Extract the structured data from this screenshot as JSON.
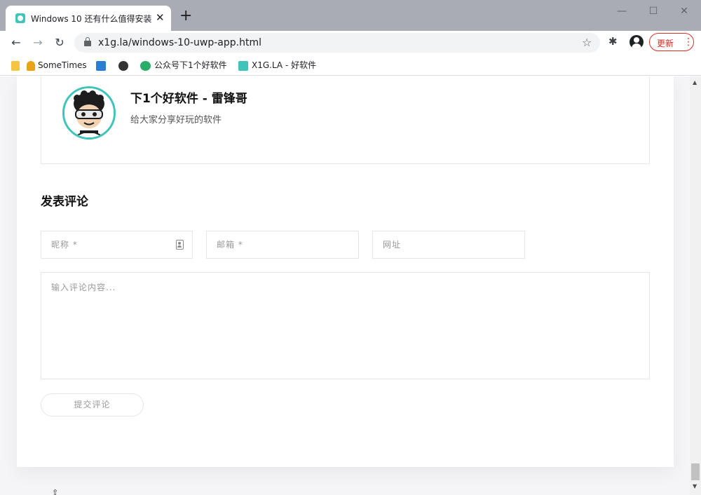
{
  "browser": {
    "tab_title": "Windows 10 还有什么值得安装",
    "tab_close": "✕",
    "new_tab": "+",
    "url": "x1g.la/windows-10-uwp-app.html",
    "update_label": "更新",
    "update_menu": "⋮",
    "window_controls": {
      "minimize": "—",
      "maximize": "☐",
      "close": "✕"
    },
    "nav": {
      "back": "←",
      "forward": "→",
      "reload": "↻"
    },
    "bookmark_star": "☆",
    "extensions": "✱"
  },
  "bookmarks": [
    {
      "label": "",
      "icon": "folder-icon",
      "color": "#f4c542"
    },
    {
      "label": "SomeTimes",
      "icon": "bell-icon",
      "color": "#e8a317"
    },
    {
      "label": "",
      "icon": "checkmark-icon",
      "color": "#2a7fd4"
    },
    {
      "label": "",
      "icon": "avatar-icon",
      "color": "#333333"
    },
    {
      "label": "公众号下1个好软件",
      "icon": "wechat-icon",
      "color": "#2aae67"
    },
    {
      "label": "X1G.LA - 好软件",
      "icon": "site-icon",
      "color": "#3ec4b8"
    }
  ],
  "author": {
    "name": "下1个好软件 - 雷锋哥",
    "description": "给大家分享好玩的软件"
  },
  "comment_form": {
    "title": "发表评论",
    "nickname_placeholder": "昵称 *",
    "email_placeholder": "邮箱 *",
    "website_placeholder": "网址",
    "content_placeholder": "输入评论内容...",
    "submit_label": "提交评论"
  },
  "colors": {
    "accent": "#3ec4b8",
    "update": "#d93025",
    "border": "#e6e6e6"
  }
}
